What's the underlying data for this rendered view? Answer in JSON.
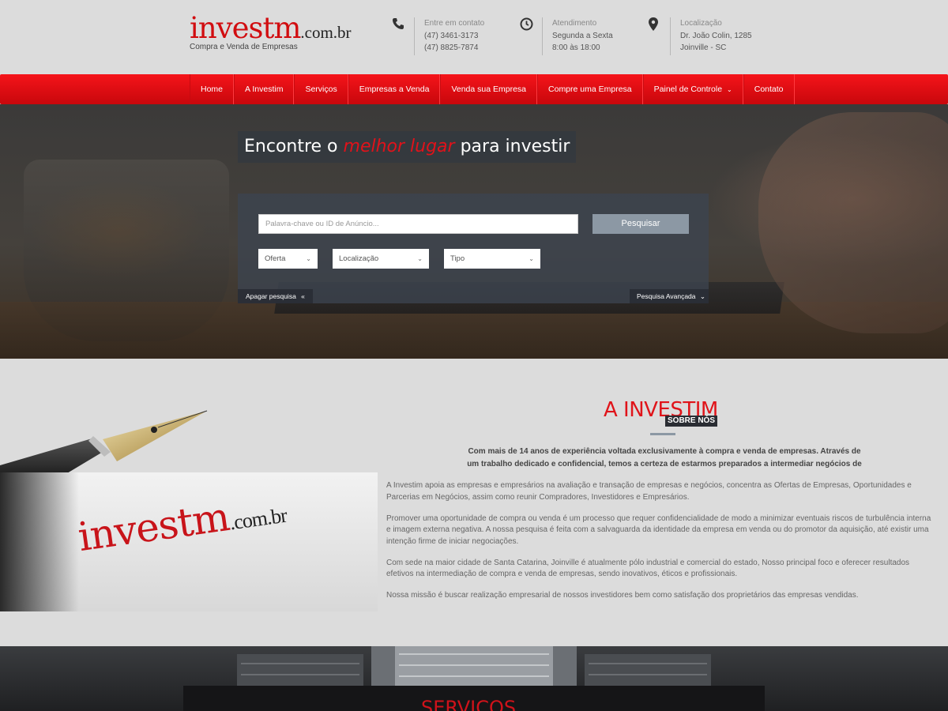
{
  "brand": {
    "name": "investm",
    "domain": ".com.br",
    "tagline": "Compra e Venda de Empresas"
  },
  "contacts": [
    {
      "icon": "phone-icon",
      "title": "Entre em contato",
      "lines": [
        "(47) 3461-3173",
        "(47) 8825-7874"
      ]
    },
    {
      "icon": "clock-icon",
      "title": "Atendimento",
      "lines": [
        "Segunda a Sexta",
        "8:00 às 18:00"
      ]
    },
    {
      "icon": "map-pin-icon",
      "title": "Localização",
      "lines": [
        "Dr. João Colin, 1285",
        "Joinville - SC"
      ]
    }
  ],
  "nav": [
    "Home",
    "A Investim",
    "Serviços",
    "Empresas a Venda",
    "Venda sua Empresa",
    "Compre uma Empresa",
    "Painel de Controle",
    "Contato"
  ],
  "hero": {
    "title_pre": "Encontre o ",
    "title_accent": "melhor lugar",
    "title_post": " para investir",
    "search_placeholder": "Palavra-chave ou ID de Anúncio...",
    "search_button": "Pesquisar",
    "selects": [
      "Oferta",
      "Localização",
      "Tipo"
    ],
    "clear_label": "Apagar pesquisa",
    "advanced_label": "Pesquisa Avançada"
  },
  "about": {
    "title": "A INVESTIM",
    "subtitle": "SOBRE NÓS",
    "lead": "Com mais de 14 anos de experiência voltada exclusivamente à compra e venda de empresas. Através de um trabalho dedicado e confidencial, temos a certeza de estarmos preparados a intermediar negócios de",
    "paragraphs": [
      "A Investim apoia as empresas e empresários na avaliação e transação de empresas e negócios, concentra as Ofertas de Empresas, Oportunidades e Parcerias em Negócios, assim como reunir Compradores, Investidores e Empresários.",
      "Promover uma oportunidade de compra ou venda é um processo que requer confidencialidade de modo a minimizar eventuais riscos de turbulência interna e imagem externa negativa. A nossa pesquisa é feita com a salvaguarda da identidade da empresa em venda ou do promotor da aquisição, até existir uma intenção firme de iniciar negociações.",
      "Com sede na maior cidade de Santa Catarina, Joinville é atualmente pólo industrial e comercial do estado, Nosso principal foco e oferecer resultados efetivos na intermediação de compra e venda de empresas, sendo inovativos, éticos e profissionais.",
      "Nossa missão é buscar realização empresarial de nossos investidores bem como satisfação dos proprietários das empresas vendidas."
    ],
    "image_logo_text": "investm",
    "image_logo_domain": ".com.br"
  },
  "services": {
    "title": "SERVIÇOS"
  }
}
